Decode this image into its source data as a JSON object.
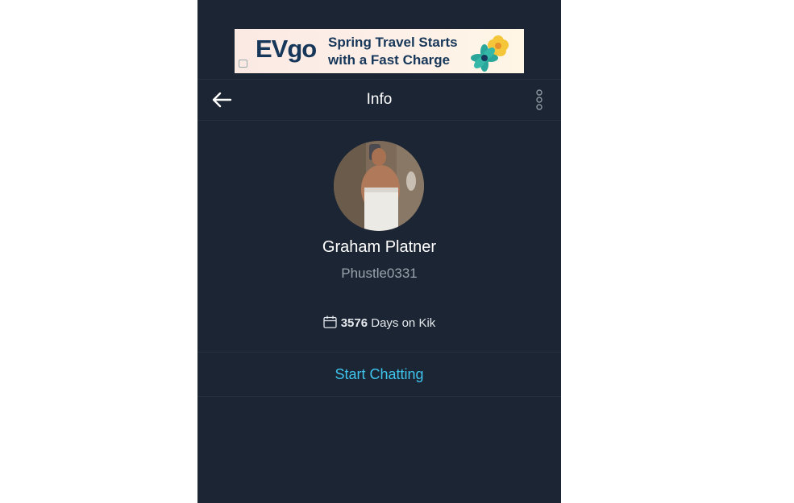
{
  "ad": {
    "logo": "EVgo",
    "line1": "Spring Travel Starts",
    "line2": "with a Fast Charge"
  },
  "nav": {
    "title": "Info",
    "back_icon": "arrow-left-icon",
    "more_icon": "more-vertical-icon"
  },
  "profile": {
    "name": "Graham Platner",
    "username": "Phustle0331",
    "days_count": "3576",
    "days_label": "Days on Kik"
  },
  "actions": {
    "start_chatting": "Start Chatting"
  },
  "colors": {
    "background": "#1b2533",
    "accent": "#3fc4ee",
    "ad_brand": "#17375a"
  }
}
